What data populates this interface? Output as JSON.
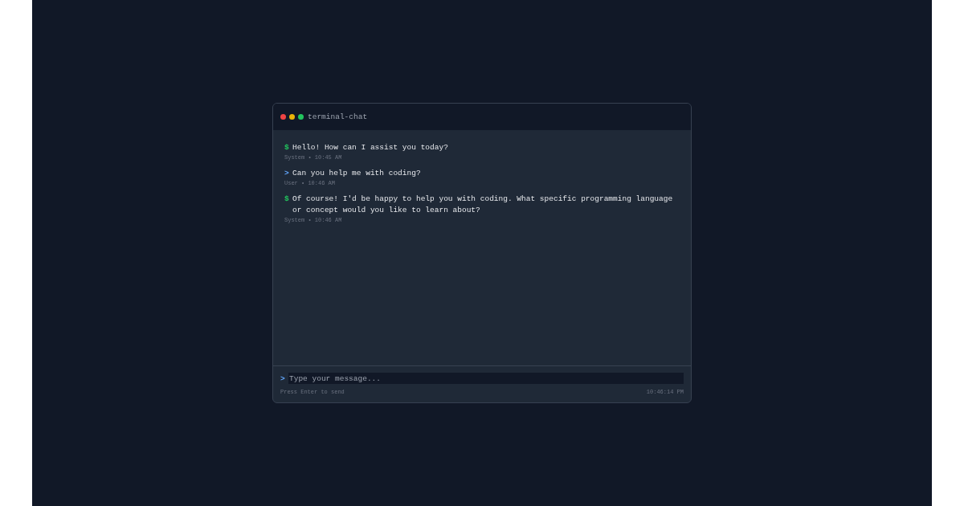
{
  "window": {
    "title": "terminal-chat"
  },
  "messages": [
    {
      "kind": "system",
      "prompt": "$",
      "text": "Hello! How can I assist you today?",
      "meta": "System • 10:45 AM"
    },
    {
      "kind": "user",
      "prompt": ">",
      "text": "Can you help me with coding?",
      "meta": "User • 10:46 AM"
    },
    {
      "kind": "system",
      "prompt": "$",
      "text": "Of course! I'd be happy to help you with coding. What specific programming language or concept would you like to learn about?",
      "meta": "System • 10:46 AM"
    }
  ],
  "input": {
    "prompt": ">",
    "placeholder": "Type your message..."
  },
  "footer": {
    "hint": "Press Enter to send",
    "time": "10:46:14 PM"
  }
}
